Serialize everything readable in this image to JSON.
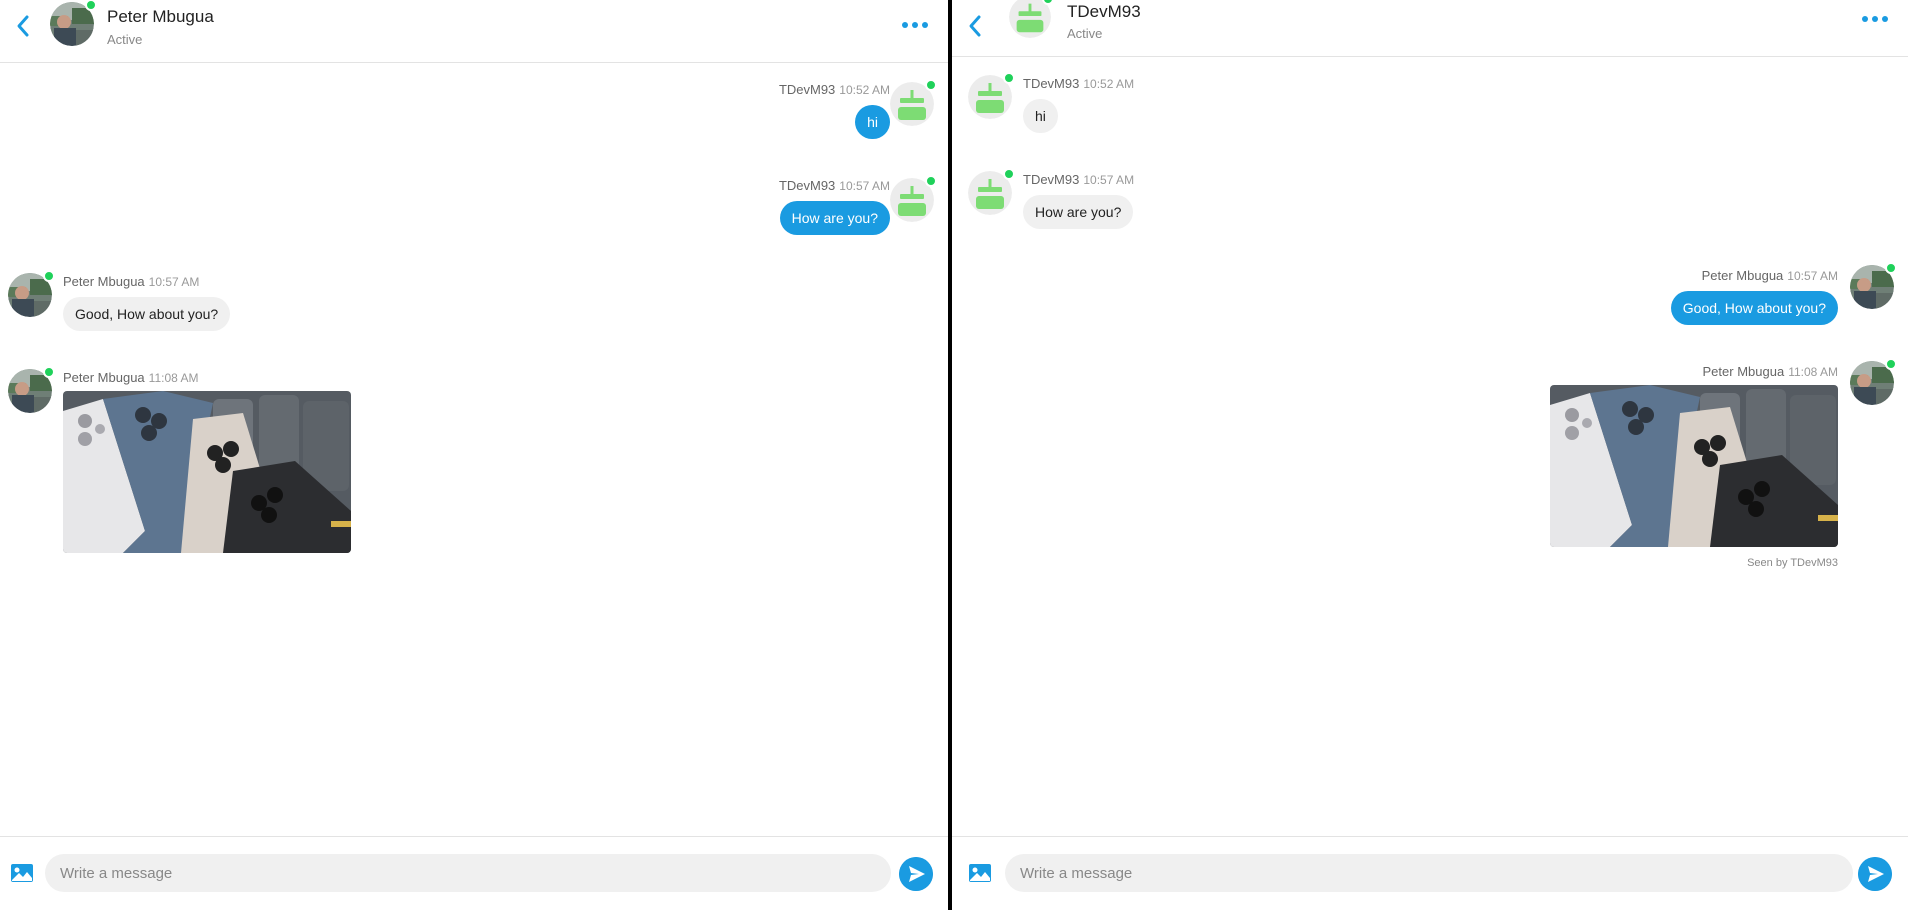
{
  "colors": {
    "accent": "#1a9be1",
    "online": "#1fd15a",
    "incoming_bubble": "#f0f0f0"
  },
  "left": {
    "header": {
      "name": "Peter Mbugua",
      "status": "Active",
      "avatar_icon": "profile-photo",
      "menu_icon": "more-dots-icon"
    },
    "messages": [
      {
        "sender": "TDevM93",
        "time": "10:52 AM",
        "text": "hi",
        "direction": "outgoing"
      },
      {
        "sender": "TDevM93",
        "time": "10:57 AM",
        "text": "How are you?",
        "direction": "outgoing"
      },
      {
        "sender": "Peter Mbugua",
        "time": "10:57 AM",
        "text": "Good, How about you?",
        "direction": "incoming"
      },
      {
        "sender": "Peter Mbugua",
        "time": "11:08 AM",
        "attachment": "photo of four phones",
        "direction": "incoming"
      }
    ],
    "composer": {
      "placeholder": "Write a message"
    }
  },
  "right": {
    "header": {
      "name": "TDevM93",
      "status": "Active",
      "avatar_icon": "green-robot-avatar",
      "menu_icon": "more-dots-icon"
    },
    "messages": [
      {
        "sender": "TDevM93",
        "time": "10:52 AM",
        "text": "hi",
        "direction": "incoming"
      },
      {
        "sender": "TDevM93",
        "time": "10:57 AM",
        "text": "How are you?",
        "direction": "incoming"
      },
      {
        "sender": "Peter Mbugua",
        "time": "10:57 AM",
        "text": "Good, How about you?",
        "direction": "outgoing"
      },
      {
        "sender": "Peter Mbugua",
        "time": "11:08 AM",
        "attachment": "photo of four phones",
        "direction": "outgoing"
      }
    ],
    "seen_by": "Seen by TDevM93",
    "composer": {
      "placeholder": "Write a message"
    }
  }
}
